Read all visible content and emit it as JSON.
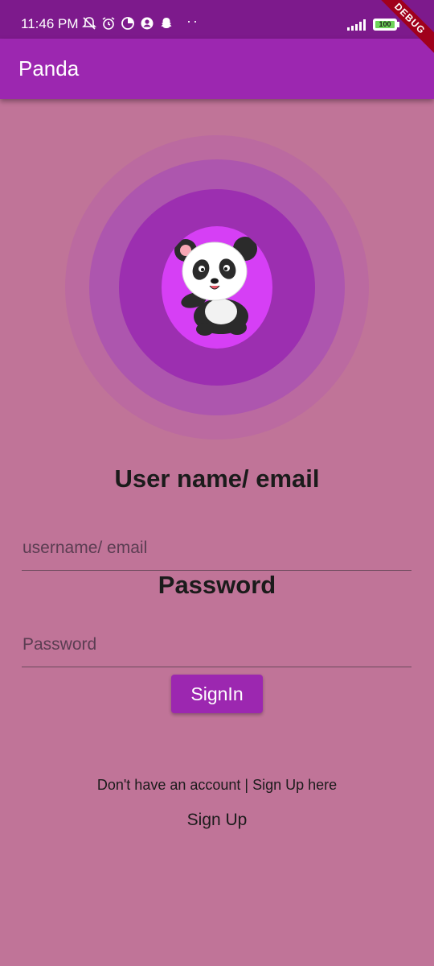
{
  "status_bar": {
    "time": "11:46 PM",
    "battery_level": "100",
    "more_dots": "··",
    "left_icons": [
      "muted-notification-icon",
      "alarm-icon",
      "data-saver-icon",
      "account-icon",
      "snapchat-icon"
    ]
  },
  "debug_banner": "DEBUG",
  "app_bar": {
    "title": "Panda"
  },
  "form": {
    "username_label": "User name/ email",
    "username_placeholder": "username/ email",
    "password_label": "Password",
    "password_placeholder": "Password",
    "signin_label": "SignIn"
  },
  "footer": {
    "hint": "Don't have an account | Sign Up here",
    "signup_label": "Sign Up"
  },
  "colors": {
    "status_bar": "#7d1a8c",
    "app_bar": "#9c27b0",
    "background": "#c07498",
    "avatar_bg": "#d63ff5",
    "button": "#9c27b0"
  }
}
